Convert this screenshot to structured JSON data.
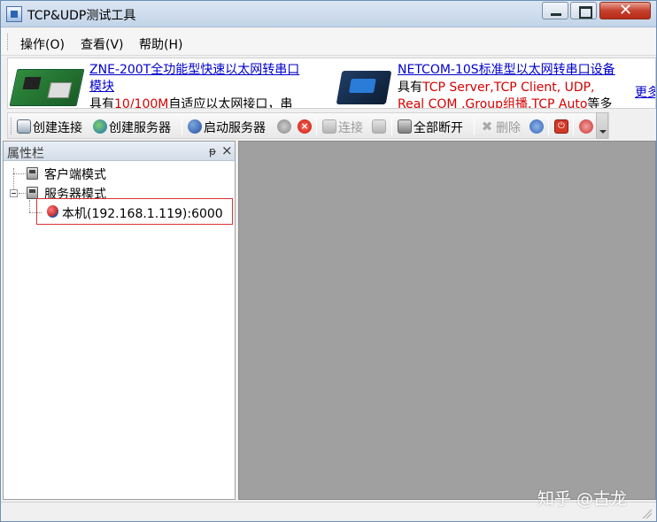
{
  "window": {
    "title": "TCP&UDP测试工具"
  },
  "menu": {
    "items": [
      "操作(O)",
      "查看(V)",
      "帮助(H)"
    ]
  },
  "banner": {
    "left_link_line1": "ZNE-200T全功能型快速以太网转串口",
    "left_link_line2": "模块",
    "left_text_a": "具有",
    "left_text_b": "10/100M",
    "left_text_c": "自适应以太网接口，串",
    "right_link": "NETCOM-10S标准型以太网转串口设备",
    "right_text_a": "具有",
    "right_text_b": "TCP Server,TCP Client, UDP,",
    "right_text_c": "Real COM ,Group组播,TCP Auto",
    "right_text_d": "等多",
    "more_link": "更多"
  },
  "toolbar": {
    "create_connection": "创建连接",
    "create_server": "创建服务器",
    "start_server": "启动服务器",
    "connect": "连接",
    "disconnect_all": "全部断开",
    "delete": "删除"
  },
  "sidebar": {
    "title": "属性栏",
    "tree": {
      "client_mode": "客户端模式",
      "server_mode": "服务器模式",
      "local_server": "本机(192.168.1.119):6000"
    }
  },
  "watermark": "知乎 @古龙",
  "colors": {
    "workspace_bg": "#a0a0a0",
    "ad_red": "#d40000",
    "link_blue": "#0000cc",
    "selection_border": "#dd3333"
  }
}
